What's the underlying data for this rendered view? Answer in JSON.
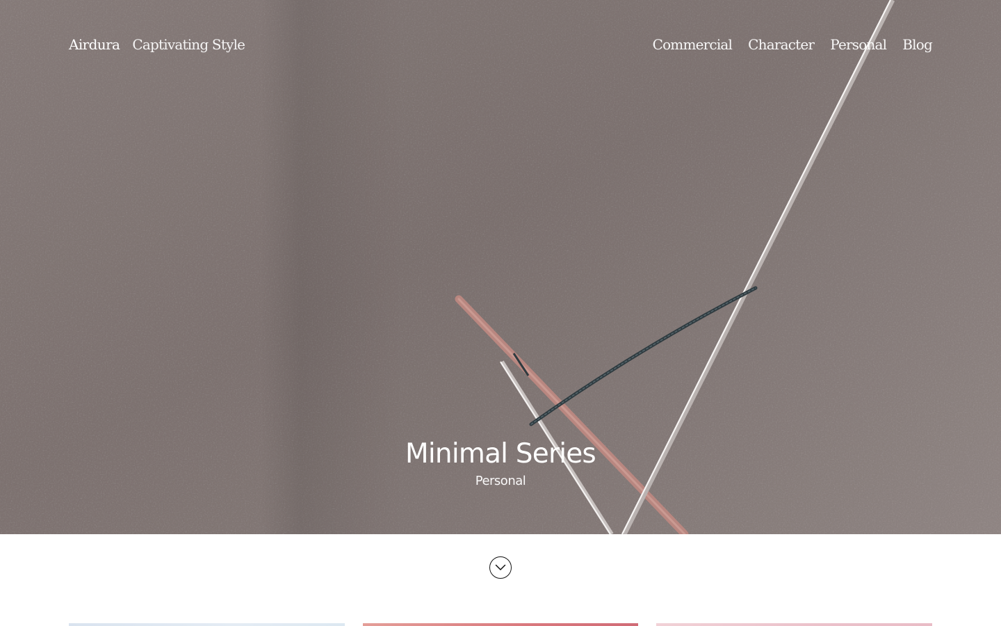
{
  "header": {
    "brand_name": "Airdura",
    "tagline": "Captivating Style",
    "nav": [
      {
        "label": "Commercial"
      },
      {
        "label": "Character"
      },
      {
        "label": "Personal"
      },
      {
        "label": "Blog"
      }
    ]
  },
  "hero": {
    "title": "Minimal Series",
    "category": "Personal"
  },
  "scroll": {
    "icon": "chevron-down-icon"
  },
  "colors": {
    "hero_wall": "#857a78",
    "text_on_hero": "#ffffff",
    "page_background": "#ffffff"
  }
}
